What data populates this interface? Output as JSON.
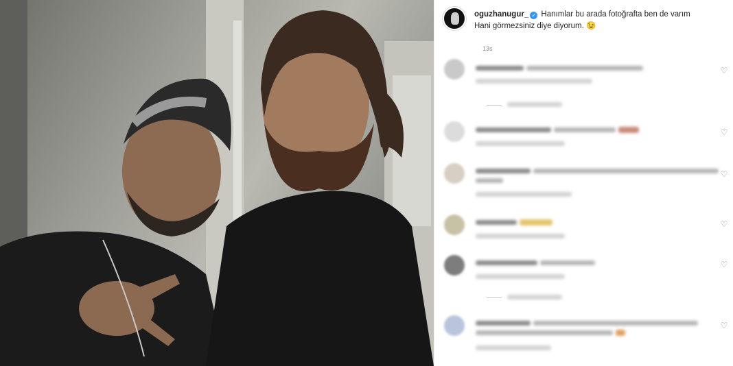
{
  "post": {
    "username": "oguzhanugur_",
    "verified_badge": "✓",
    "caption_line1": "Hanımlar bu arada fotoğrafta ben de varım",
    "caption_line2": "Hani görmezsiniz diye diyorum.",
    "caption_emoji": "😉",
    "time_ago": "13s"
  },
  "comments": [
    {
      "avatar_color": "#c9c9c9",
      "has_heart": true
    },
    {
      "avatar_color": "#dcdcdc",
      "has_heart": true
    },
    {
      "avatar_color": "#d8cfc4",
      "has_heart": true
    },
    {
      "avatar_color": "#c7c1a6",
      "has_heart": true
    },
    {
      "avatar_color": "#7d7d7d",
      "has_heart": true
    },
    {
      "avatar_color": "#b9c4dd",
      "has_heart": true
    }
  ],
  "icons": {
    "heart": "♡"
  },
  "colors": {
    "verified": "#3897f0",
    "text": "#262626",
    "muted": "#8e8e8e"
  }
}
